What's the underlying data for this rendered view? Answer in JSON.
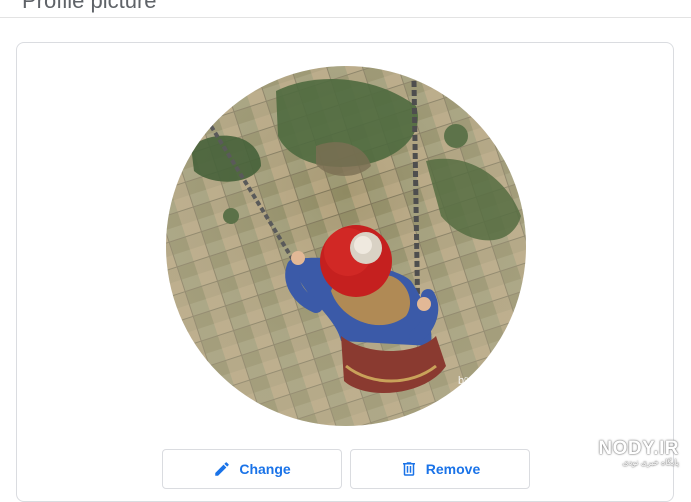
{
  "header": {
    "title": "Profile picture"
  },
  "buttons": {
    "change_label": "Change",
    "change_icon": "pencil-icon",
    "remove_label": "Remove",
    "remove_icon": "trash-icon"
  },
  "watermark": {
    "text": "NODY.IR",
    "subtext": "پایگاه خبری نودی"
  },
  "colors": {
    "accent": "#1a73e8",
    "border": "#dadce0"
  }
}
